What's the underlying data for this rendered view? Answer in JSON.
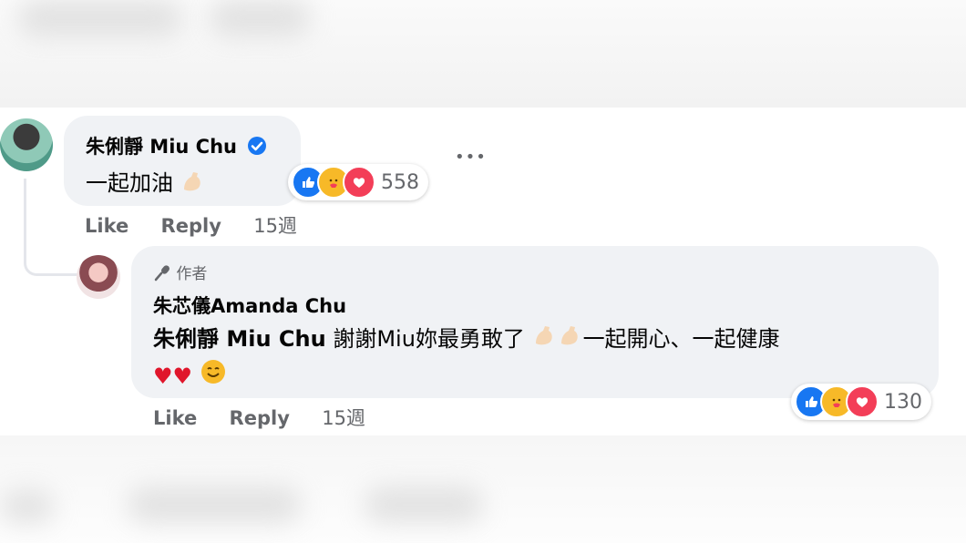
{
  "comment": {
    "author": "朱俐靜 Miu Chu",
    "text": "一起加油",
    "reaction_count": "558",
    "like_label": "Like",
    "reply_label": "Reply",
    "time": "15週",
    "menu_label": "•••"
  },
  "reply": {
    "author_badge": "作者",
    "author": "朱芯儀Amanda Chu",
    "mention": "朱俐靜 Miu Chu",
    "text_line1": " 謝謝Miu妳最勇敢了",
    "text_line1_end": "一起開心、一起健康",
    "reaction_count": "130",
    "like_label": "Like",
    "reply_label": "Reply",
    "time": "15週"
  },
  "colors": {
    "bubble": "#f0f2f5",
    "secondary_text": "#65676b",
    "verified": "#1877f2",
    "like_blue": "#1877f2",
    "love_red": "#f33e58",
    "care_yellow": "#f7b928"
  }
}
